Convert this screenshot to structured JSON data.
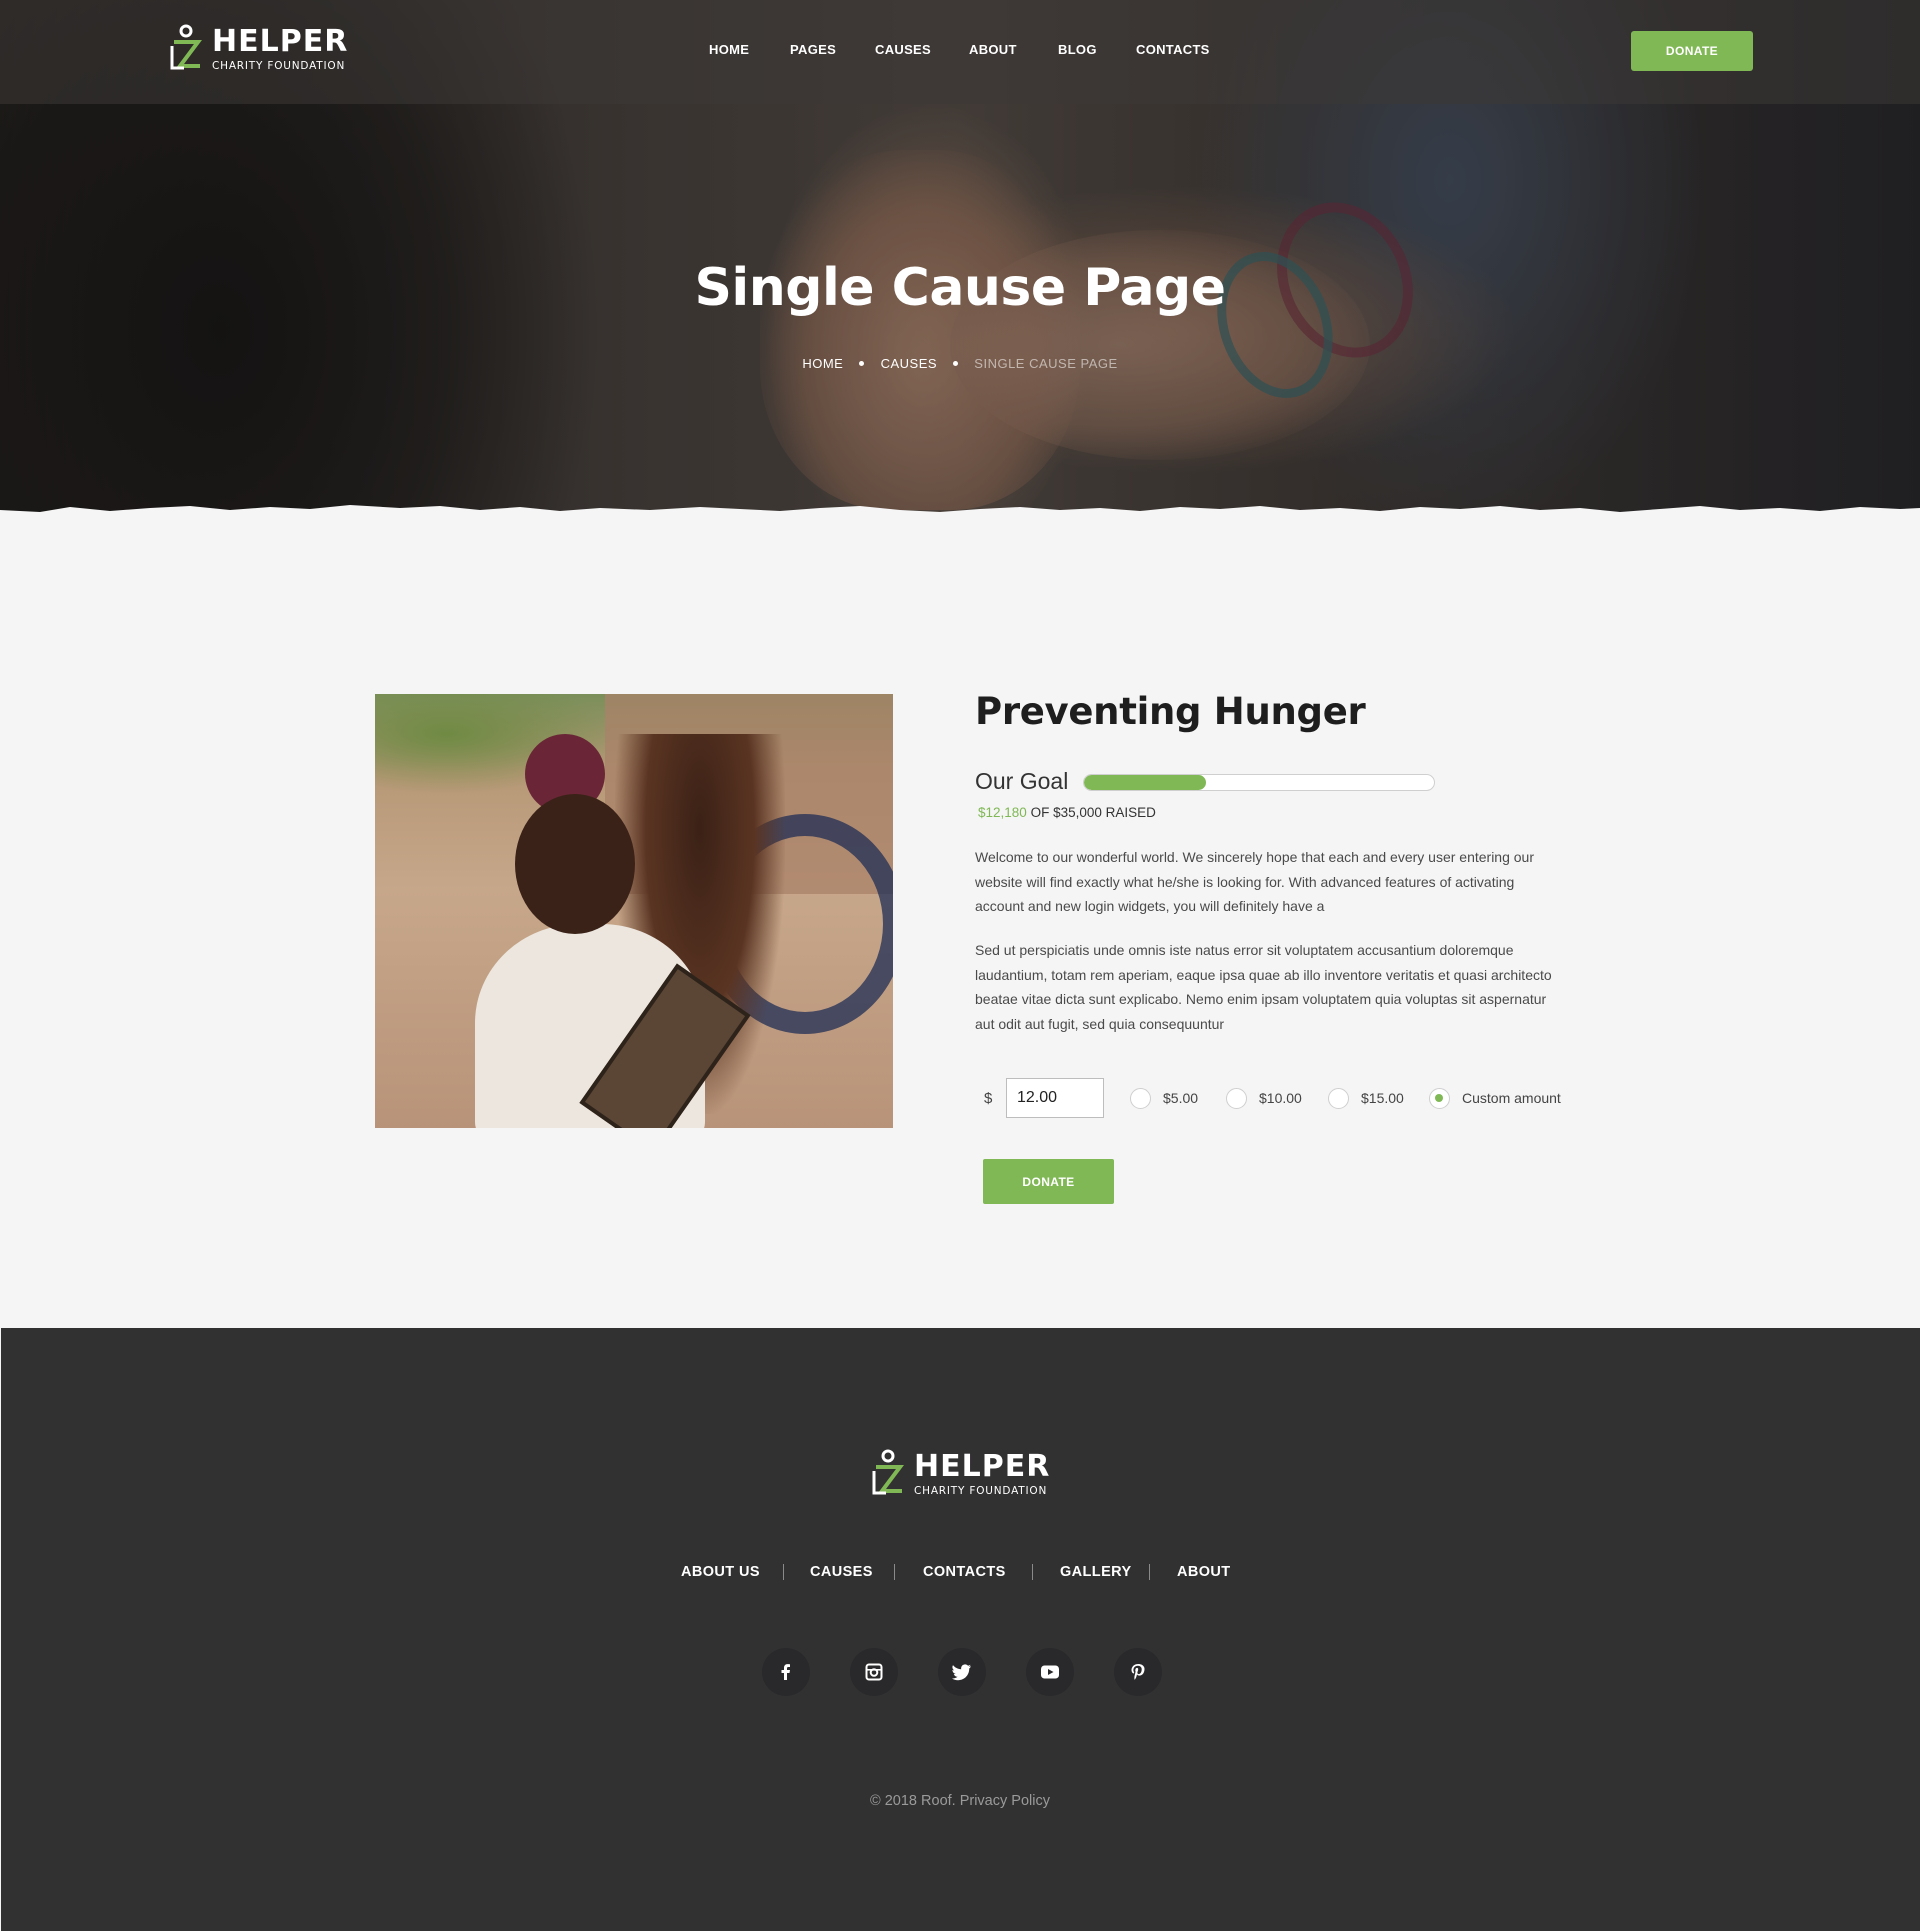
{
  "brand": {
    "name": "HELPER",
    "tagline": "CHARITY FOUNDATION",
    "accent_color": "#80b856",
    "footer_bg": "#323132"
  },
  "nav": {
    "items": [
      {
        "label": "HOME"
      },
      {
        "label": "PAGES"
      },
      {
        "label": "CAUSES"
      },
      {
        "label": "ABOUT"
      },
      {
        "label": "BLOG"
      },
      {
        "label": "CONTACTS"
      }
    ],
    "donate_label": "DONATE"
  },
  "hero": {
    "title": "Single Cause Page",
    "breadcrumb": [
      "HOME",
      "CAUSES",
      "SINGLE CAUSE PAGE"
    ]
  },
  "cause": {
    "title": "Preventing Hunger",
    "goal_label": "Our Goal",
    "raised_amount": "$12,180",
    "raised_suffix": "OF $35,000 RAISED",
    "progress_fraction": 0.348,
    "description_1": "Welcome to our wonderful world. We sincerely hope that each and every user entering our website will find exactly what he/she is looking for. With advanced features of activating account and new login widgets, you will definitely have a",
    "description_2": "Sed ut perspiciatis unde omnis iste natus error sit voluptatem accusantium doloremque laudantium, totam rem aperiam, eaque ipsa quae ab illo inventore veritatis et quasi architecto beatae vitae dicta sunt explicabo. Nemo enim ipsam voluptatem quia voluptas sit aspernatur aut odit aut fugit, sed quia consequuntur",
    "currency_symbol": "$",
    "amount_value": "12.00",
    "options": [
      {
        "label": "$5.00",
        "checked": false
      },
      {
        "label": "$10.00",
        "checked": false
      },
      {
        "label": "$15.00",
        "checked": false
      },
      {
        "label": "Custom amount",
        "checked": true
      }
    ],
    "donate_label": "DONATE"
  },
  "footer": {
    "links": [
      "ABOUT US",
      "CAUSES",
      "CONTACTS",
      "GALLERY",
      "ABOUT"
    ],
    "social": [
      "facebook-icon",
      "instagram-icon",
      "twitter-icon",
      "youtube-icon",
      "pinterest-icon"
    ],
    "copyright": "© 2018 Roof. Privacy Policy"
  }
}
